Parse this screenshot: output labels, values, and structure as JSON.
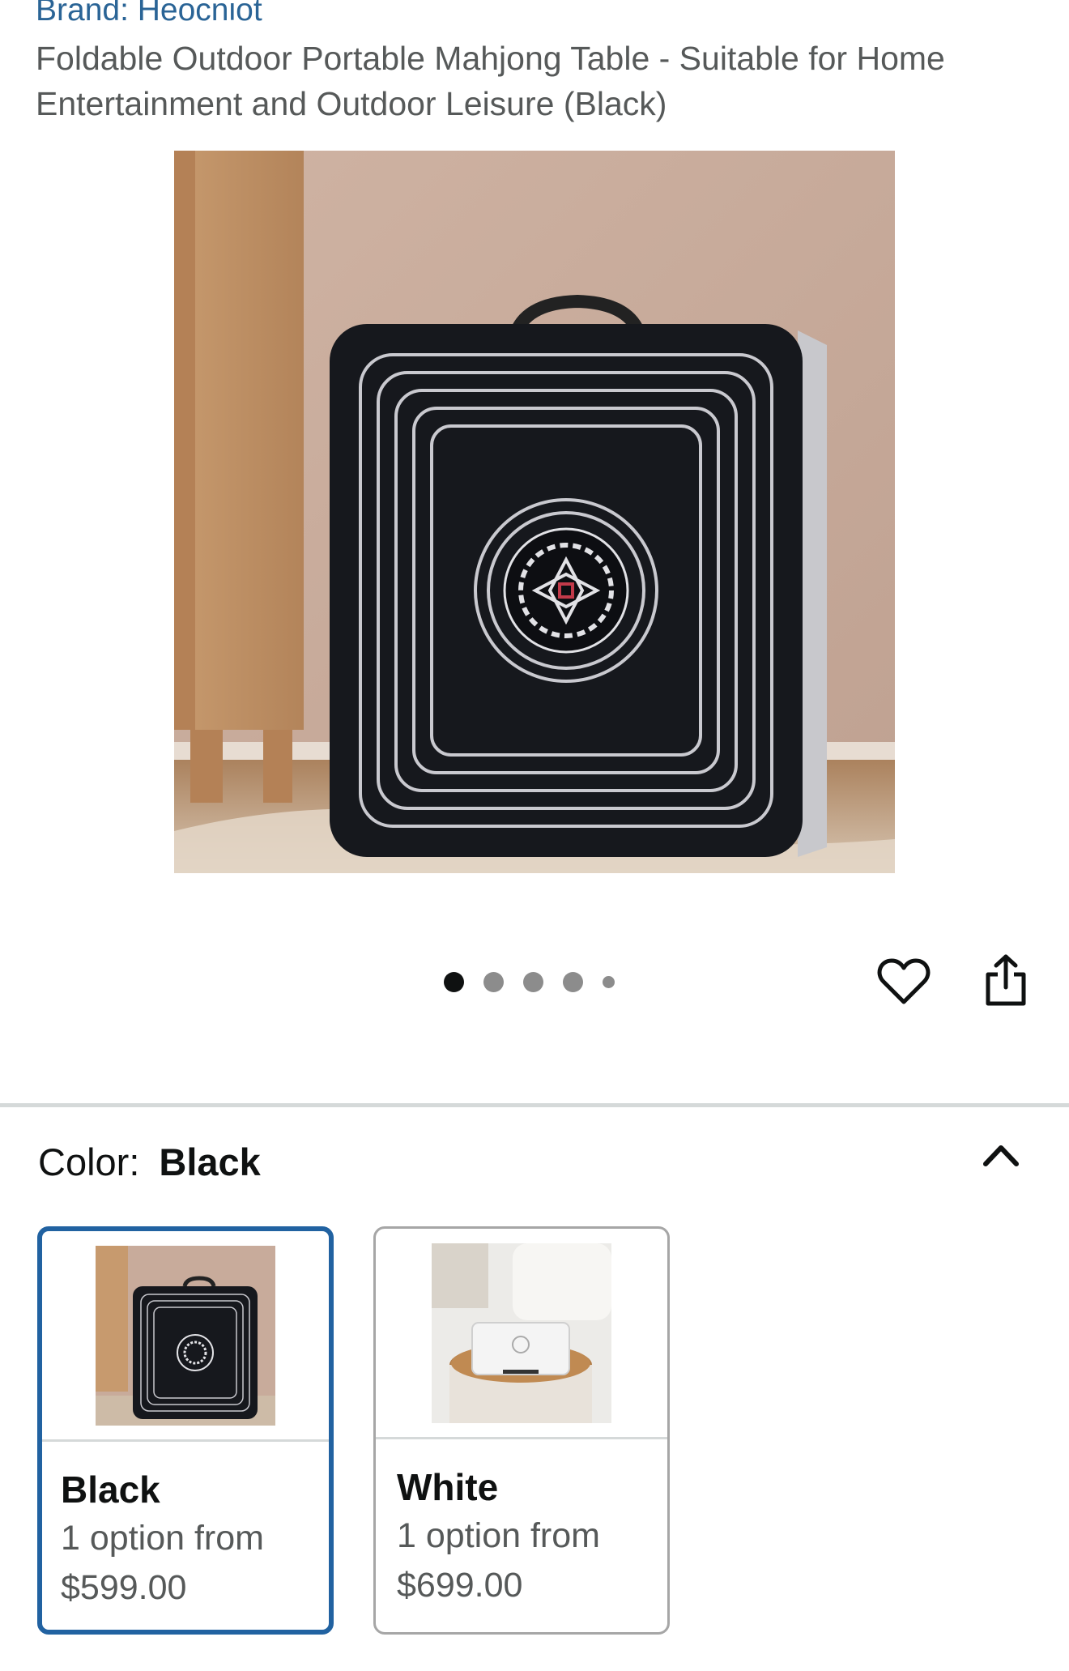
{
  "product": {
    "brand": "Brand: Heocniot",
    "title": "Foldable Outdoor Portable Mahjong Table - Suitable for Home Entertainment and Outdoor Leisure (Black)"
  },
  "gallery": {
    "image_count": 5,
    "active_index": 0,
    "icons": {
      "favorite": "heart-icon",
      "share": "share-icon"
    }
  },
  "variation": {
    "label": "Color:",
    "selected_value": "Black",
    "options": [
      {
        "name": "Black",
        "availability": "1 option from",
        "price": "$599.00",
        "selected": true
      },
      {
        "name": "White",
        "availability": "1 option from",
        "price": "$699.00",
        "selected": false
      }
    ]
  },
  "colors": {
    "brand_link": "#2a6496",
    "selected_border": "#2162a1",
    "muted_text": "#565959"
  }
}
